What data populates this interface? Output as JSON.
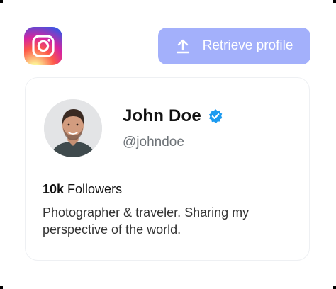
{
  "header": {
    "logo_icon": "instagram-icon",
    "retrieve_button": {
      "label": "Retrieve profile",
      "icon": "upload-icon",
      "color": "#a3b0fb"
    }
  },
  "profile": {
    "name": "John Doe",
    "verified": true,
    "verified_icon": "verified-badge-icon",
    "verified_color": "#1d9bf0",
    "handle": "@johndoe",
    "followers_count": "10k",
    "followers_label": "Followers",
    "bio": "Photographer & traveler. Sharing my perspective of the world."
  }
}
